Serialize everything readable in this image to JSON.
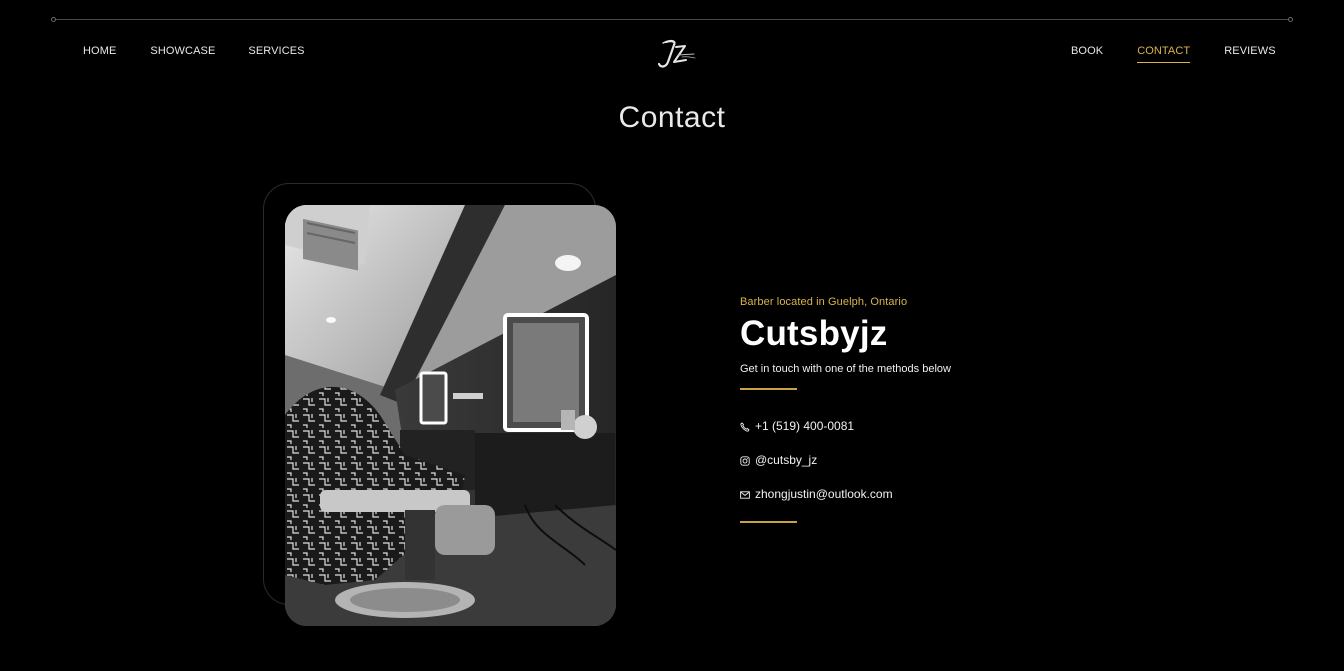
{
  "nav": {
    "left": [
      {
        "label": "HOME"
      },
      {
        "label": "SHOWCASE"
      },
      {
        "label": "SERVICES"
      }
    ],
    "right": [
      {
        "label": "BOOK"
      },
      {
        "label": "CONTACT",
        "active": true
      },
      {
        "label": "REVIEWS"
      }
    ]
  },
  "logo": {
    "icon": "jz-monogram-logo"
  },
  "page": {
    "title": "Contact"
  },
  "info": {
    "eyebrow": "Barber located in Guelph, Ontario",
    "brand": "Cutsbyjz",
    "tagline": "Get in touch with one of the methods below"
  },
  "contacts": {
    "phone": {
      "icon": "phone-icon",
      "value": "+1 (519) 400-0081"
    },
    "instagram": {
      "icon": "instagram-icon",
      "value": "@cutsby_jz"
    },
    "email": {
      "icon": "mail-icon",
      "value": "zhongjustin@outlook.com"
    }
  },
  "colors": {
    "background": "#000000",
    "accent": "#d9b44a",
    "text": "#ffffff"
  }
}
